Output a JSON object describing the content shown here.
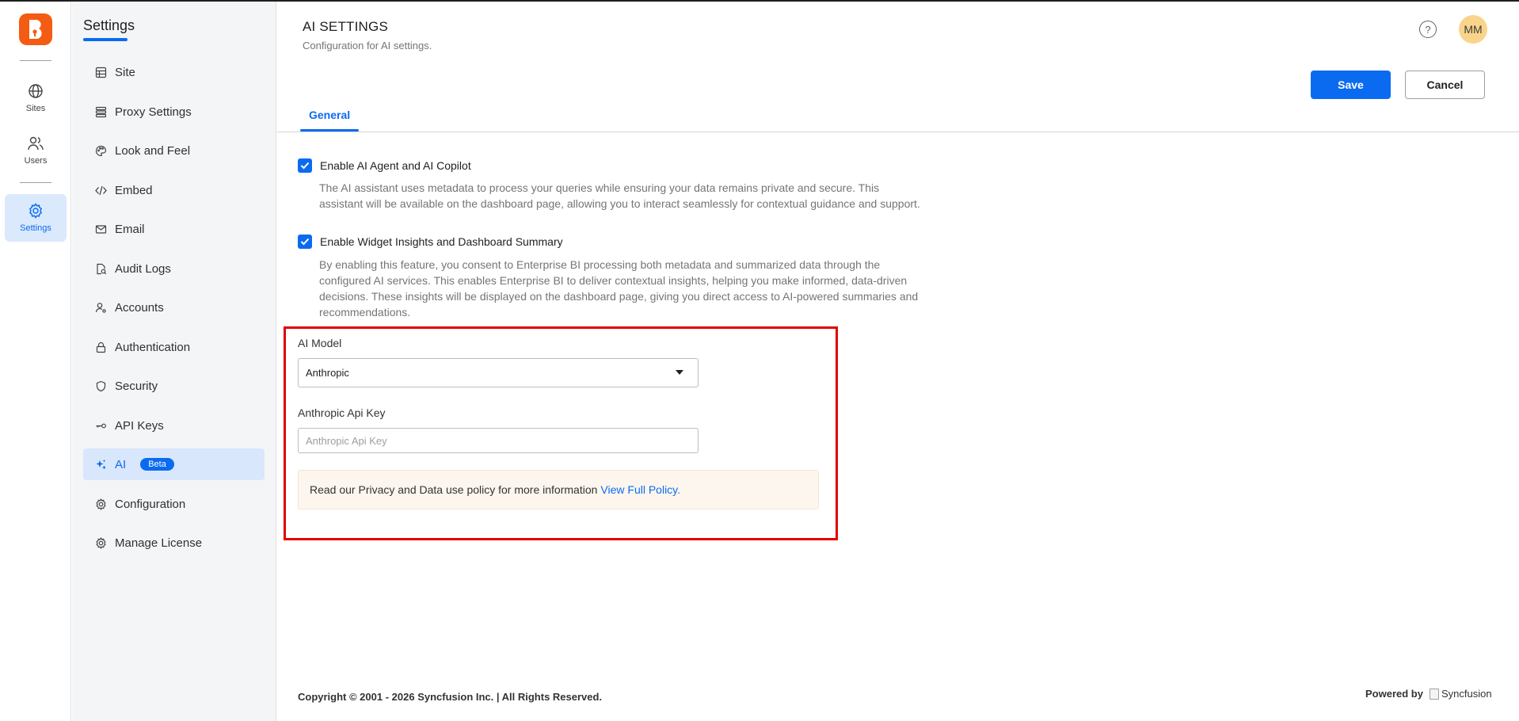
{
  "rail": {
    "items": [
      {
        "label": "Sites",
        "icon": "globe-icon"
      },
      {
        "label": "Users",
        "icon": "users-icon"
      },
      {
        "label": "Settings",
        "icon": "gear-icon",
        "active": true
      }
    ]
  },
  "nav": {
    "title": "Settings",
    "items": [
      {
        "label": "Site",
        "icon": "site-icon"
      },
      {
        "label": "Proxy Settings",
        "icon": "proxy-icon"
      },
      {
        "label": "Look and Feel",
        "icon": "palette-icon"
      },
      {
        "label": "Embed",
        "icon": "code-icon"
      },
      {
        "label": "Email",
        "icon": "mail-icon"
      },
      {
        "label": "Audit Logs",
        "icon": "audit-icon"
      },
      {
        "label": "Accounts",
        "icon": "accounts-icon"
      },
      {
        "label": "Authentication",
        "icon": "lock-icon"
      },
      {
        "label": "Security",
        "icon": "shield-icon"
      },
      {
        "label": "API Keys",
        "icon": "key-icon"
      },
      {
        "label": "AI",
        "icon": "sparkle-icon",
        "badge": "Beta",
        "active": true
      },
      {
        "label": "Configuration",
        "icon": "gear-icon"
      },
      {
        "label": "Manage License",
        "icon": "gear-icon"
      }
    ]
  },
  "header": {
    "title": "AI SETTINGS",
    "subtitle": "Configuration for AI settings.",
    "avatar_initials": "MM",
    "help_glyph": "?"
  },
  "actions": {
    "save_label": "Save",
    "cancel_label": "Cancel"
  },
  "tabs": [
    {
      "label": "General",
      "active": true
    }
  ],
  "options": {
    "agent": {
      "label": "Enable AI Agent and AI Copilot",
      "checked": true,
      "description": "The AI assistant uses metadata to process your queries while ensuring your data remains private and secure. This assistant will be available on the dashboard page, allowing you to interact seamlessly for contextual guidance and support."
    },
    "insights": {
      "label": "Enable Widget Insights and Dashboard Summary",
      "checked": true,
      "description": "By enabling this feature, you consent to Enterprise BI processing both metadata and summarized data through the configured AI services. This enables Enterprise BI to deliver contextual insights, helping you make informed, data-driven decisions. These insights will be displayed on the dashboard page, giving you direct access to AI-powered summaries and recommendations."
    }
  },
  "ai_model": {
    "label": "AI Model",
    "value": "Anthropic"
  },
  "api_key": {
    "label": "Anthropic Api Key",
    "placeholder": "Anthropic Api Key",
    "value": ""
  },
  "notice": {
    "text": "Read our Privacy and Data use policy for more information",
    "link": "View Full Policy."
  },
  "footer": {
    "copyright": "Copyright © 2001 - 2026 Syncfusion Inc. | All Rights Reserved.",
    "powered_by": "Powered by",
    "brand": "Syncfusion"
  },
  "colors": {
    "accent": "#0b6bf0",
    "logo": "#f45b13",
    "highlight": "#e00000",
    "avatar": "#f9d48a"
  }
}
